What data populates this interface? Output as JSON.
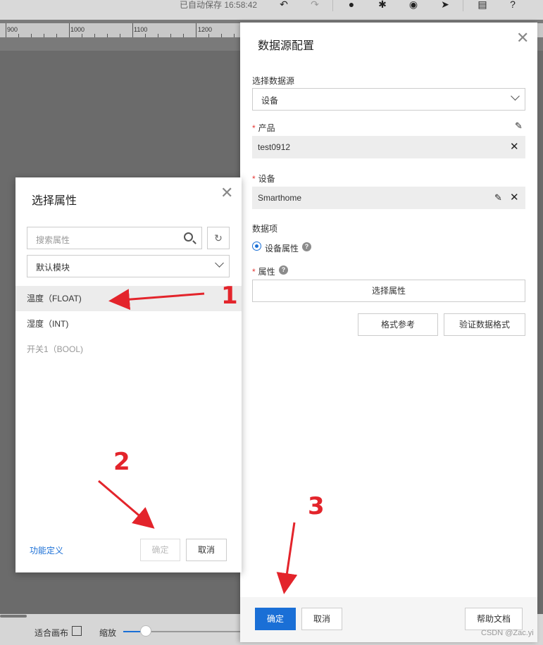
{
  "toolbar": {
    "autosave": "已自动保存 16:58:42",
    "icons": [
      "undo-icon",
      "redo-icon",
      "check-circle-icon",
      "bug-icon",
      "eye-icon",
      "send-icon",
      "document-icon",
      "help-icon"
    ]
  },
  "ruler": {
    "labels": [
      "900",
      "1000",
      "1100",
      "1200"
    ]
  },
  "canvas_bottom": {
    "fit_label": "适合画布",
    "zoom_label": "缩放"
  },
  "datasource_panel": {
    "title": "数据源配置",
    "source_label": "选择数据源",
    "source_value": "设备",
    "product_label": "产品",
    "product_value": "test0912",
    "device_label": "设备",
    "device_value": "Smarthome",
    "data_item_label": "数据项",
    "data_item_option": "设备属性",
    "attr_label": "属性",
    "select_attr_button": "选择属性",
    "format_ref_button": "格式参考",
    "validate_button": "验证数据格式",
    "confirm_button": "确定",
    "cancel_button": "取消",
    "help_doc_button": "帮助文档"
  },
  "attr_dialog": {
    "title": "选择属性",
    "search_placeholder": "搜索属性",
    "module_value": "默认模块",
    "items": [
      {
        "label": "温度（FLOAT)",
        "state": "selected"
      },
      {
        "label": "湿度（INT)",
        "state": "normal"
      },
      {
        "label": "开关1（BOOL)",
        "state": "disabled"
      }
    ],
    "func_def_link": "功能定义",
    "confirm_button": "确定",
    "cancel_button": "取消"
  },
  "annotations": [
    "1",
    "2",
    "3"
  ],
  "watermark": "CSDN @Zac.yi",
  "colors": {
    "primary": "#1a6fd6",
    "annotation": "#e3242b"
  }
}
